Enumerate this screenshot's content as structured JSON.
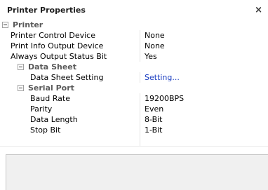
{
  "window": {
    "title": "Printer Properties",
    "close_glyph": "×"
  },
  "categories": {
    "printer": "Printer",
    "data_sheet": "Data Sheet",
    "serial_port": "Serial Port"
  },
  "props": {
    "printer_control_device": {
      "name": "Printer Control Device",
      "value": "None"
    },
    "print_info_output_device": {
      "name": "Print Info Output Device",
      "value": "None"
    },
    "always_output_status_bit": {
      "name": "Always Output Status Bit",
      "value": "Yes"
    },
    "data_sheet_setting": {
      "name": "Data Sheet Setting",
      "value": "Setting..."
    },
    "baud_rate": {
      "name": "Baud Rate",
      "value": "19200BPS"
    },
    "parity": {
      "name": "Parity",
      "value": "Even"
    },
    "data_length": {
      "name": "Data Length",
      "value": "8-Bit"
    },
    "stop_bit": {
      "name": "Stop Bit",
      "value": "1-Bit"
    }
  },
  "colors": {
    "category_text": "#595959",
    "link": "#1a3dc1",
    "description_bg": "#f0f0f0"
  }
}
